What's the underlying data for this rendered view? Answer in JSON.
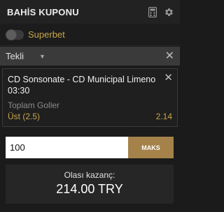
{
  "header": {
    "title": "BAHİS KUPONU",
    "icons": [
      "calculator-icon",
      "gear-icon"
    ]
  },
  "superbet": {
    "label": "Superbet",
    "enabled": false
  },
  "bet_type": {
    "label": "Tekli"
  },
  "bet": {
    "match": "CD Sonsonate - CD Municipal Limeno",
    "time": "03:30",
    "market": "Toplam Goller",
    "selection": "Üst (2.5)",
    "odds": "2.14"
  },
  "stake": {
    "value": "100",
    "max_label": "MAKS"
  },
  "winnings": {
    "label": "Olası kazanç:",
    "value": "214.00 TRY"
  },
  "colors": {
    "accent": "#c9a54a",
    "button": "#a4824a",
    "background": "#1b1b1b"
  }
}
